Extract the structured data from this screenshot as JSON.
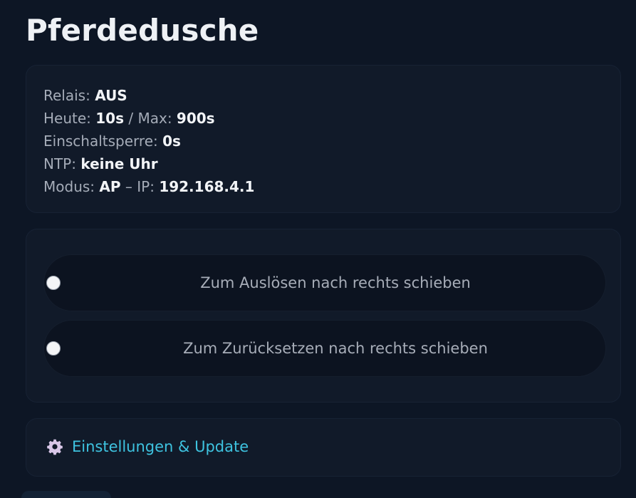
{
  "page": {
    "title": "Pferdedusche"
  },
  "status": {
    "relais_label": "Relais:",
    "relais_value": "AUS",
    "heute_label": "Heute:",
    "heute_value": "10s",
    "max_sep": "/ Max:",
    "max_value": "900s",
    "sperre_label": "Einschaltsperre:",
    "sperre_value": "0s",
    "ntp_label": "NTP:",
    "ntp_value": "keine Uhr",
    "modus_label": "Modus:",
    "modus_value": "AP",
    "ip_sep": "– IP:",
    "ip_value": "192.168.4.1"
  },
  "sliders": {
    "trigger_label": "Zum Auslösen nach rechts schieben",
    "trigger_position": 0,
    "reset_label": "Zum Zurücksetzen nach rechts schieben",
    "reset_position": 0
  },
  "settings": {
    "icon": "gear-icon",
    "link_label": "Einstellungen & Update"
  },
  "colors": {
    "background": "#0d1625",
    "card": "#111a29",
    "link": "#3ec3e0",
    "gear": "#d9c7e8"
  }
}
